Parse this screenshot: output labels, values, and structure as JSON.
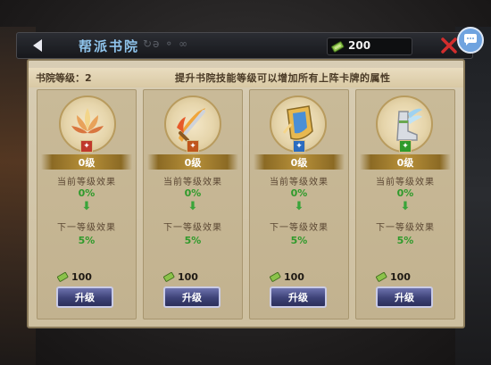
{
  "topbar": {
    "title": "帮派书院",
    "title_decoration": "↻ǝ ⚬ ∞",
    "currency_value": "200",
    "back_icon": "back-arrow-icon",
    "close_icon": "close-x-icon",
    "chat_icon": "chat-bubble-icon"
  },
  "header": {
    "academy_level": "书院等级：2",
    "info": "提升书院技能等级可以增加所有上阵卡牌的属性"
  },
  "labels": {
    "current_effect": "当前等级效果",
    "next_effect": "下一等级效果",
    "upgrade": "升级"
  },
  "cards": [
    {
      "skill_icon": "lotus-icon",
      "badge_color": "#c0392b",
      "level": "0级",
      "current": "0%",
      "next": "5%",
      "cost": "100"
    },
    {
      "skill_icon": "flaming-sword-icon",
      "badge_color": "#c0561c",
      "level": "0级",
      "current": "0%",
      "next": "5%",
      "cost": "100"
    },
    {
      "skill_icon": "shield-icon",
      "badge_color": "#2b6cc0",
      "level": "0级",
      "current": "0%",
      "next": "5%",
      "cost": "100"
    },
    {
      "skill_icon": "winged-boot-icon",
      "badge_color": "#2f9a2b",
      "level": "0级",
      "current": "0%",
      "next": "5%",
      "cost": "100"
    }
  ],
  "colors": {
    "accent_title": "#8fc4ec",
    "effect_green": "#2f9a2b",
    "button_blue": "#3d4277"
  }
}
